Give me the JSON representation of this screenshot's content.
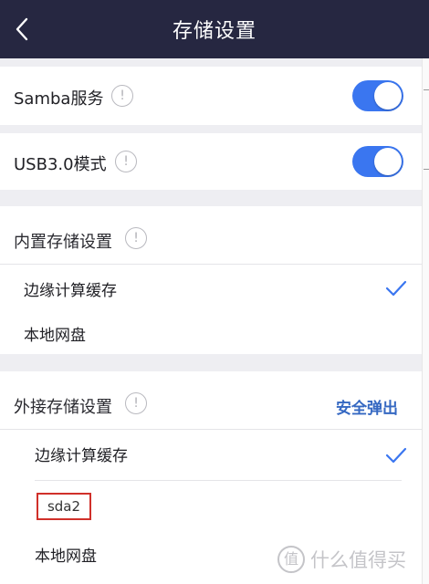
{
  "header": {
    "title": "存储设置"
  },
  "samba": {
    "label": "Samba服务",
    "enabled": true
  },
  "usb": {
    "label": "USB3.0模式",
    "enabled": true
  },
  "internal": {
    "title": "内置存储设置",
    "options": [
      {
        "label": "边缘计算缓存",
        "selected": true
      },
      {
        "label": "本地网盘",
        "selected": false
      }
    ]
  },
  "external": {
    "title": "外接存储设置",
    "eject_label": "安全弹出",
    "options": [
      {
        "label": "边缘计算缓存",
        "selected": true
      },
      {
        "label": "本地网盘",
        "selected": false
      }
    ],
    "device": "sda2"
  },
  "watermark": {
    "text": "什么值得买",
    "logo": "值"
  },
  "colors": {
    "header_bg": "#262741",
    "accent": "#3a76f0",
    "link": "#3568c2",
    "highlight_border": "#d0302a"
  }
}
